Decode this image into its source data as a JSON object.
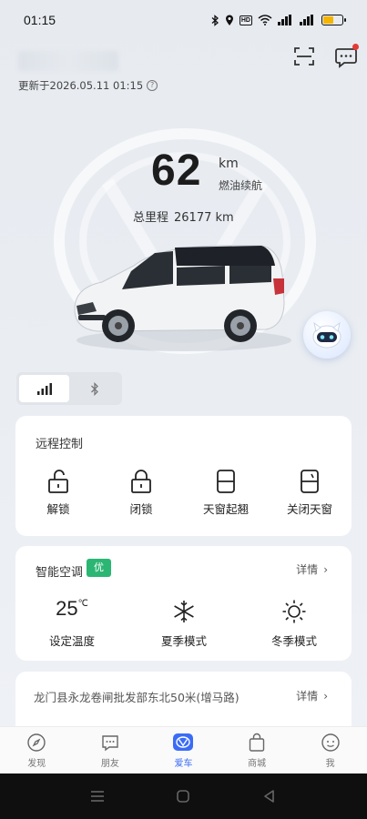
{
  "status_bar": {
    "time": "01:15",
    "battery_level": 0.55
  },
  "header": {
    "update_time": "更新于2026.05.11 01:15",
    "help_icon": "?"
  },
  "vehicle": {
    "range_value": "62",
    "range_unit": "km",
    "range_label": "燃油续航",
    "odometer_label": "总里程",
    "odometer_value": "26177 km"
  },
  "remote_control": {
    "title": "远程控制",
    "items": [
      {
        "label": "解锁",
        "icon": "unlock-icon"
      },
      {
        "label": "闭锁",
        "icon": "lock-icon"
      },
      {
        "label": "天窗起翘",
        "icon": "sunroof-tilt-icon"
      },
      {
        "label": "关闭天窗",
        "icon": "sunroof-close-icon"
      }
    ]
  },
  "climate": {
    "title": "智能空调",
    "badge": "优",
    "detail": "详情",
    "temperature_value": "25",
    "temperature_unit": "℃",
    "temperature_label": "设定温度",
    "summer_label": "夏季模式",
    "winter_label": "冬季模式"
  },
  "location": {
    "address": "龙门县永龙卷闸批发部东北50米(增马路)",
    "detail": "详情"
  },
  "bottom_nav": [
    {
      "label": "发现",
      "icon": "compass-icon"
    },
    {
      "label": "朋友",
      "icon": "chat-icon"
    },
    {
      "label": "爱车",
      "icon": "car-brand-icon"
    },
    {
      "label": "商城",
      "icon": "shop-bag-icon"
    },
    {
      "label": "我",
      "icon": "profile-icon"
    }
  ],
  "colors": {
    "accent": "#3b6cf6",
    "badge_green": "#2bb673",
    "battery": "#f5b400"
  }
}
